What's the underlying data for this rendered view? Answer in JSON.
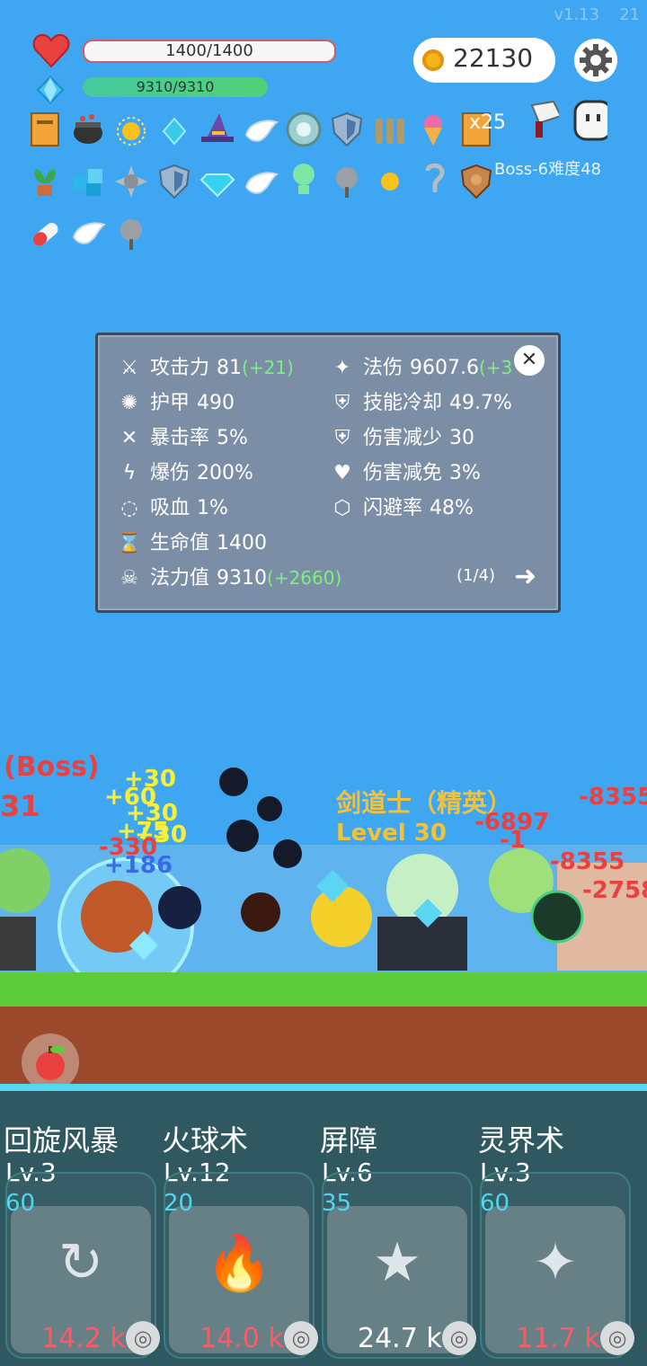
{
  "version": "v1.13",
  "version_trail": "21",
  "hp_text": "1400/1400",
  "hp_fraction": 1.0,
  "mp_text": "9310/9310",
  "mp_fraction": 1.0,
  "coins": "22130",
  "stack_badge": "x25",
  "boss_label": "Boss-6难度48",
  "stats": {
    "left": [
      {
        "icon": "axe-icon",
        "glyph": "⚔",
        "label": "攻击力",
        "value": "81",
        "bonus": "(+21)"
      },
      {
        "icon": "sun-icon",
        "glyph": "✺",
        "label": "护甲",
        "value": "490",
        "bonus": ""
      },
      {
        "icon": "crosshair-icon",
        "glyph": "✕",
        "label": "暴击率",
        "value": "5%",
        "bonus": ""
      },
      {
        "icon": "lightning-icon",
        "glyph": "ϟ",
        "label": "爆伤",
        "value": "200%",
        "bonus": ""
      },
      {
        "icon": "ring-icon",
        "glyph": "◌",
        "label": "吸血",
        "value": "1%",
        "bonus": ""
      },
      {
        "icon": "hourglass-icon",
        "glyph": "⌛",
        "label": "生命值",
        "value": "1400",
        "bonus": ""
      },
      {
        "icon": "skull-icon",
        "glyph": "☠",
        "label": "法力值",
        "value": "9310",
        "bonus": "(+2660)"
      }
    ],
    "right": [
      {
        "icon": "wand-icon",
        "glyph": "✦",
        "label": "法伤",
        "value": "9607.6",
        "bonus": "(+3"
      },
      {
        "icon": "shield-icon",
        "glyph": "⛨",
        "label": "技能冷却",
        "value": "49.7%",
        "bonus": ""
      },
      {
        "icon": "heart-shield-icon",
        "glyph": "⛨",
        "label": "伤害减少",
        "value": "30",
        "bonus": ""
      },
      {
        "icon": "heart-icon",
        "glyph": "♥",
        "label": "伤害减免",
        "value": "3%",
        "bonus": ""
      },
      {
        "icon": "hexagon-icon",
        "glyph": "⬡",
        "label": "闪避率",
        "value": "48%",
        "bonus": ""
      }
    ],
    "pager": "(1/4)",
    "close_glyph": "✕",
    "next_glyph": "➜"
  },
  "enemy": {
    "boss_tag": "(Boss)",
    "number_left": "31",
    "name": "剑道士（精英）",
    "level": "Level 30"
  },
  "floating_numbers": {
    "heals": [
      "+30",
      "+60",
      "+30",
      "+75",
      "+30"
    ],
    "hits": [
      "-330",
      "+186"
    ],
    "damage": [
      "-6897",
      "-8355",
      "-2758",
      "-1",
      "-8355"
    ]
  },
  "skills": [
    {
      "name": "回旋风暴",
      "level": "Lv.3",
      "cost": "60",
      "damage": "14.2 k",
      "icon": "whirlwind-icon",
      "glyph": "↻",
      "dmg_color": "#ff5a6a"
    },
    {
      "name": "火球术",
      "level": "Lv.12",
      "cost": "20",
      "damage": "14.0 k",
      "icon": "fire-icon",
      "glyph": "🔥",
      "dmg_color": "#ff5a6a"
    },
    {
      "name": "屏障",
      "level": "Lv.6",
      "cost": "35",
      "damage": "24.7 k",
      "icon": "shield-icon",
      "glyph": "★",
      "dmg_color": "#ffffff"
    },
    {
      "name": "灵界术",
      "level": "Lv.3",
      "cost": "60",
      "damage": "11.7 k",
      "icon": "magic-wand-icon",
      "glyph": "✦",
      "dmg_color": "#ff5a6a"
    }
  ],
  "colors": {
    "sky": "#3fa6f2",
    "panel": "#7b8ea6",
    "mana_cost": "#4fd7ee",
    "bonus_green": "#7cf07c"
  }
}
